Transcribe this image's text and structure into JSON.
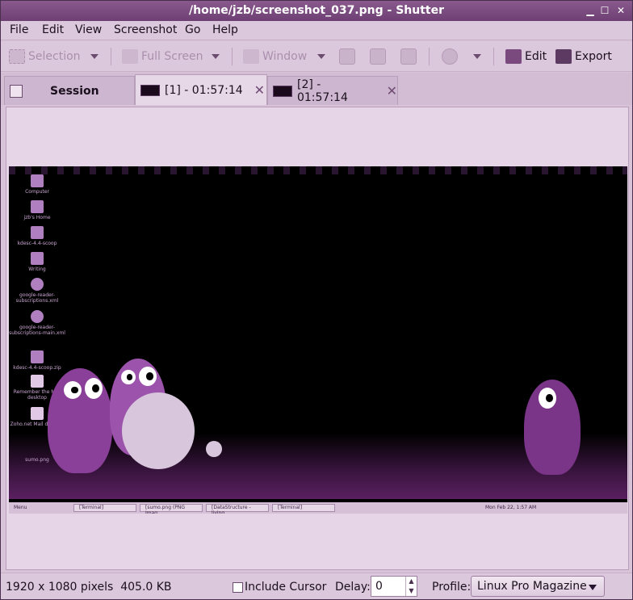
{
  "window": {
    "title": "/home/jzb/screenshot_037.png - Shutter",
    "controls": [
      "minimize",
      "maximize",
      "close"
    ]
  },
  "menubar": {
    "items": [
      {
        "label": "File",
        "accel": "F"
      },
      {
        "label": "Edit",
        "accel": "E"
      },
      {
        "label": "View",
        "accel": "V"
      },
      {
        "label": "Screenshot",
        "accel": "S"
      },
      {
        "label": "Go",
        "accel": "G"
      },
      {
        "label": "Help",
        "accel": "H"
      }
    ]
  },
  "toolbar": {
    "selection_label": "Selection",
    "fullscreen_label": "Full Screen",
    "window_label": "Window",
    "edit_label": "Edit",
    "export_label": "Export"
  },
  "tabs": [
    {
      "label": "Session"
    },
    {
      "label": "[1] - 01:57:14",
      "active": true
    },
    {
      "label": "[2] - 01:57:14",
      "active": false
    }
  ],
  "desktop": {
    "icons": [
      "Computer",
      "jzb's Home",
      "kdesc-4.4-scoop",
      "Writing",
      "google-reader-subscriptions.xml",
      "google-reader-subscriptions-main.xml",
      "kdesc-4.4-scoop.zip",
      "Remember the Milk desktop",
      "Zoho.net Mail desktop",
      "sumo.png"
    ],
    "panel": {
      "menu_label": "Menu",
      "task_buttons": [
        "[Terminal]",
        "[sumo.png (PNG Imag...",
        "[DataStructure - living...",
        "[Terminal]"
      ],
      "clock": "Mon Feb 22, 1:57 AM"
    }
  },
  "statusbar": {
    "image_info": "1920 x 1080 pixels  405.0 KB",
    "include_cursor_label": "Include Cursor",
    "include_cursor_checked": false,
    "delay_label": "Delay:",
    "delay_value": "0",
    "profile_label": "Profile:",
    "profile_value": "Linux Pro Magazine"
  },
  "colors": {
    "titlebar": "#7a4a7f",
    "chrome": "#dcc8dc",
    "accent": "#6d3f72"
  }
}
